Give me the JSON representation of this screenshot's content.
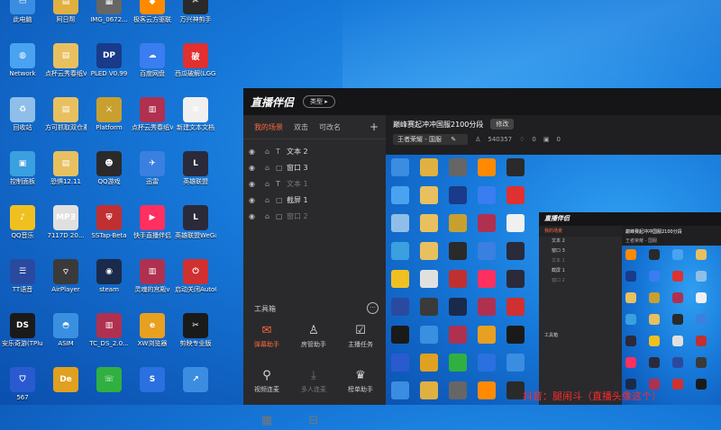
{
  "desktop": {
    "icons": [
      {
        "label": "此电脑",
        "color": "#3a8de0",
        "glyph": "▭"
      },
      {
        "label": "阿日帮",
        "color": "#e0b040",
        "glyph": "▤"
      },
      {
        "label": "IMG_0672...",
        "color": "#666666",
        "glyph": "▦"
      },
      {
        "label": "极客云方驱联",
        "color": "#ff8a00",
        "glyph": "◆"
      },
      {
        "label": "万兴神剪手",
        "color": "#2a2a2a",
        "glyph": "✂"
      },
      {
        "label": "Network",
        "color": "#4aa3f0",
        "glyph": "◍"
      },
      {
        "label": "点杯云秀春纸V1.8.8",
        "color": "#e8c060",
        "glyph": "▤"
      },
      {
        "label": "PLED V0.99",
        "color": "#1a3a8a",
        "glyph": "DP"
      },
      {
        "label": "百度网盘",
        "color": "#3a7df0",
        "glyph": "☁"
      },
      {
        "label": "西瓜破解(LGG)",
        "color": "#e03030",
        "glyph": "破"
      },
      {
        "label": "回收站",
        "color": "#8fbfe8",
        "glyph": "♻"
      },
      {
        "label": "方可抓取双仓素版",
        "color": "#e8c060",
        "glyph": "▤"
      },
      {
        "label": "Platform",
        "color": "#c8a030",
        "glyph": "⚔"
      },
      {
        "label": "点杯云秀春纸V1.8.8",
        "color": "#b03050",
        "glyph": "▥"
      },
      {
        "label": "新建文本文档",
        "color": "#f0f0f0",
        "glyph": "≡"
      },
      {
        "label": "控制面板",
        "color": "#3aa0e0",
        "glyph": "▣"
      },
      {
        "label": "恐惧12.11",
        "color": "#e8c060",
        "glyph": "▤"
      },
      {
        "label": "QQ游戏",
        "color": "#2a2a2a",
        "glyph": "☻"
      },
      {
        "label": "迅雷",
        "color": "#3a80e0",
        "glyph": "✈"
      },
      {
        "label": "英雄联盟",
        "color": "#2a2a3a",
        "glyph": "L"
      },
      {
        "label": "QQ音乐",
        "color": "#f0c020",
        "glyph": "♪"
      },
      {
        "label": "7117D 20...",
        "color": "#e0e0e0",
        "glyph": "MP3"
      },
      {
        "label": "SSTap-Beta",
        "color": "#c03030",
        "glyph": "⛨"
      },
      {
        "label": "快手直播伴侣",
        "color": "#ff3060",
        "glyph": "▶"
      },
      {
        "label": "英雄联盟WeGame版",
        "color": "#2a2a3a",
        "glyph": "L"
      },
      {
        "label": "TT语音",
        "color": "#2a4aa0",
        "glyph": "☰"
      },
      {
        "label": "AirPlayer",
        "color": "#3a3a3a",
        "glyph": "⌔"
      },
      {
        "label": "steam",
        "color": "#1a2a4a",
        "glyph": "◉"
      },
      {
        "label": "灵魂的宫殿v",
        "color": "#b03050",
        "glyph": "▥"
      },
      {
        "label": "启动关闭AutoOFF4...",
        "color": "#d03030",
        "glyph": "⏻"
      },
      {
        "label": "安乐奇游(TPlus)",
        "color": "#1a1a1a",
        "glyph": "DS"
      },
      {
        "label": "ASIM",
        "color": "#3a90e0",
        "glyph": "◓"
      },
      {
        "label": "TC_DS_2.0...",
        "color": "#b03050",
        "glyph": "▥"
      },
      {
        "label": "XW浏览器",
        "color": "#e8a020",
        "glyph": "e"
      },
      {
        "label": "剪映专业版",
        "color": "#1a1a1a",
        "glyph": "✂"
      },
      {
        "label": "567",
        "color": "#2a5ad0",
        "glyph": "⛉"
      },
      {
        "label": "",
        "color": "#e0a020",
        "glyph": "De"
      },
      {
        "label": "",
        "color": "#30b040",
        "glyph": "☏"
      },
      {
        "label": "",
        "color": "#2a70e0",
        "glyph": "S"
      },
      {
        "label": "",
        "color": "#3a8de0",
        "glyph": "↗"
      }
    ]
  },
  "app": {
    "logo": "直播伴侣",
    "type_button": "类型 ▸",
    "tabs": [
      {
        "label": "我的场景",
        "active": true
      },
      {
        "label": "双击",
        "active": false
      },
      {
        "label": "可改名",
        "active": false
      }
    ],
    "add": "+",
    "scenes": [
      {
        "label": "文本 2",
        "kind": "T",
        "dim": false
      },
      {
        "label": "窗口 3",
        "kind": "▢",
        "dim": false
      },
      {
        "label": "文本 1",
        "kind": "T",
        "dim": true
      },
      {
        "label": "截屏 1",
        "kind": "▢",
        "dim": false
      },
      {
        "label": "窗口 2",
        "kind": "▢",
        "dim": true
      }
    ],
    "tools_header": "工具箱",
    "tools_more": "···",
    "tools": [
      {
        "label": "弹幕助手",
        "icon": "✉",
        "state": "hot"
      },
      {
        "label": "房管助手",
        "icon": "♙",
        "state": "normal"
      },
      {
        "label": "主播任务",
        "icon": "☑",
        "state": "normal"
      },
      {
        "label": "视频连麦",
        "icon": "⚲",
        "state": "normal"
      },
      {
        "label": "多人连麦",
        "icon": "⤓",
        "state": "dim"
      },
      {
        "label": "榜单助手",
        "icon": "♛",
        "state": "normal"
      },
      {
        "label": "",
        "icon": "▦",
        "state": "dim"
      },
      {
        "label": "",
        "icon": "⊟",
        "state": "dim"
      }
    ],
    "stream_title": "巅峰赛起冲冲国服2100分段",
    "modify_button": "修改",
    "game_tag": "王者荣耀 - 国服",
    "edit_icon": "✎",
    "viewers": "540357",
    "likes": "0",
    "gifts": "0",
    "nested_logo": "直播伴侣",
    "nested_title": "巅峰赛起冲冲国服2100分段",
    "nested_tools_header": "工具箱"
  },
  "watermark": "抖音：腿闹斗（直播头像这个）"
}
